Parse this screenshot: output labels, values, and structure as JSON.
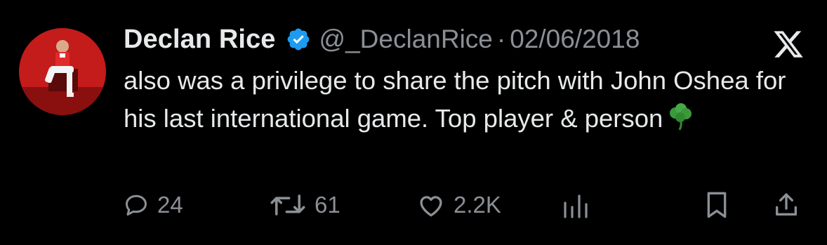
{
  "author": {
    "display_name": "Declan Rice",
    "handle": "@_DeclanRice",
    "separator": "·",
    "date": "02/06/2018",
    "verified": true
  },
  "post": {
    "text": "also was a privilege to share the pitch with John Oshea for his last international game. Top player & person",
    "emoji": "shamrock-emoji"
  },
  "actions": {
    "replies": "24",
    "reposts": "61",
    "likes": "2.2K"
  },
  "icons": [
    "verified-badge-icon",
    "x-logo-icon",
    "reply-icon",
    "repost-icon",
    "like-icon",
    "views-icon",
    "bookmark-icon",
    "share-icon"
  ],
  "colors": {
    "background": "#000000",
    "text": "#e7e9ea",
    "secondary": "#8b9096",
    "verified": "#1d9bf0",
    "shamrock": "#3a9a3a"
  }
}
